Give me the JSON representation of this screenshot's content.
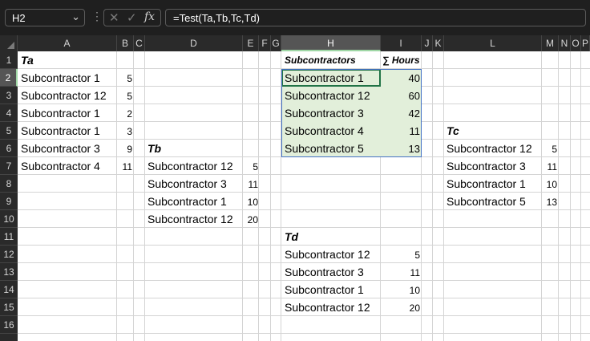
{
  "namebox": {
    "value": "H2"
  },
  "formula_bar": {
    "formula": "=Test(Ta,Tb,Tc,Td)",
    "fx_label": "fx"
  },
  "columns": [
    "A",
    "B",
    "C",
    "D",
    "E",
    "F",
    "G",
    "H",
    "I",
    "J",
    "K",
    "L",
    "M",
    "N",
    "O",
    "P"
  ],
  "rows": [
    "1",
    "2",
    "3",
    "4",
    "5",
    "6",
    "7",
    "8",
    "9",
    "10",
    "11",
    "12",
    "13",
    "14",
    "15",
    "16"
  ],
  "selected_column": "H",
  "selected_row": "2",
  "table_ta": {
    "title": "Ta",
    "rows": [
      {
        "name": "Subcontractor 1",
        "hours": "5"
      },
      {
        "name": "Subcontractor 12",
        "hours": "5"
      },
      {
        "name": "Subcontractor 1",
        "hours": "2"
      },
      {
        "name": "Subcontractor 1",
        "hours": "3"
      },
      {
        "name": "Subcontractor 3",
        "hours": "9"
      },
      {
        "name": "Subcontractor 4",
        "hours": "11"
      }
    ]
  },
  "table_tb": {
    "title": "Tb",
    "rows": [
      {
        "name": "Subcontractor 12",
        "hours": "5"
      },
      {
        "name": "Subcontractor 3",
        "hours": "11"
      },
      {
        "name": "Subcontractor 1",
        "hours": "10"
      },
      {
        "name": "Subcontractor 12",
        "hours": "20"
      }
    ]
  },
  "result": {
    "header_name": "Subcontractors",
    "header_hours": "∑ Hours",
    "rows": [
      {
        "name": "Subcontractor 1",
        "hours": "40"
      },
      {
        "name": "Subcontractor 12",
        "hours": "60"
      },
      {
        "name": "Subcontractor 3",
        "hours": "42"
      },
      {
        "name": "Subcontractor 4",
        "hours": "11"
      },
      {
        "name": "Subcontractor 5",
        "hours": "13"
      }
    ]
  },
  "table_td": {
    "title": "Td",
    "rows": [
      {
        "name": "Subcontractor 12",
        "hours": "5"
      },
      {
        "name": "Subcontractor 3",
        "hours": "11"
      },
      {
        "name": "Subcontractor 1",
        "hours": "10"
      },
      {
        "name": "Subcontractor 12",
        "hours": "20"
      }
    ]
  },
  "table_tc": {
    "title": "Tc",
    "rows": [
      {
        "name": "Subcontractor 12",
        "hours": "5"
      },
      {
        "name": "Subcontractor 3",
        "hours": "11"
      },
      {
        "name": "Subcontractor 1",
        "hours": "10"
      },
      {
        "name": "Subcontractor 5",
        "hours": "13"
      }
    ]
  },
  "colors": {
    "selection_fill": "#e2efda",
    "selection_border": "#4472c4",
    "active_cell": "#217346"
  }
}
